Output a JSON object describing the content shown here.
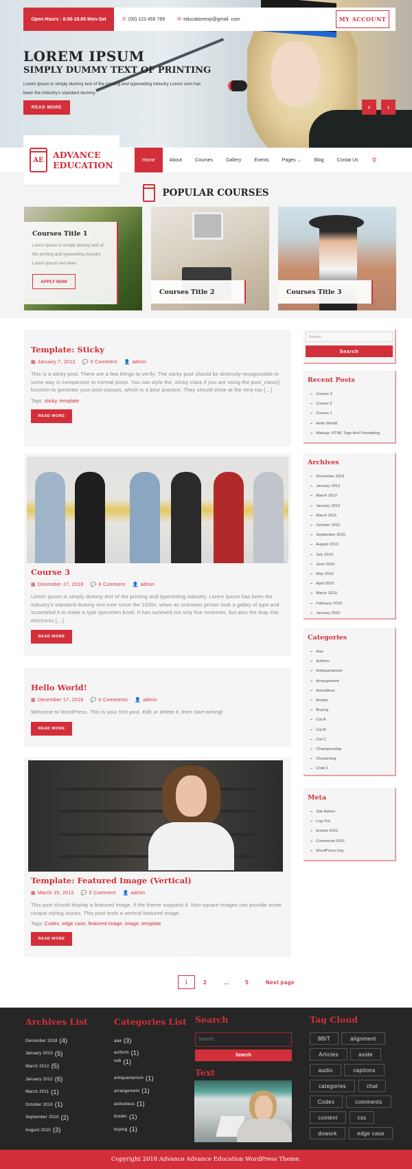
{
  "topbar": {
    "hours": "Open Hours : 8.00-18.00 Mon-Sat",
    "phone": "(00) 123 456 789",
    "email": "educationexp@gmail .com",
    "my_account": "MY ACCOUNT"
  },
  "hero": {
    "title": "LOREM IPSUM",
    "subtitle": "SIMPLY DUMMY TEXT OF PRINTING",
    "text": "Lorem Ipsum is simply dummy text of the printing and typesetting industry Lorem sum has been the industry's standard dummy.",
    "read_more": "READ MORE",
    "prev_icon": "‹",
    "next_icon": "›"
  },
  "logo": {
    "initials": "AE",
    "line1": "ADVANCE",
    "line2": "EDUCATION"
  },
  "nav": {
    "items": [
      "Home",
      "About",
      "Courses",
      "Gallery",
      "Events",
      "Pages",
      "Blog",
      "Contat Us"
    ],
    "active": "Home",
    "dropdown_icon": "⌄",
    "search_icon": "⚲"
  },
  "popular": {
    "title": "POPULAR COURSES",
    "courses": [
      {
        "title": "Courses Title 1",
        "text": "Lorem Ipsum is simply dummy text of the printing and typesetting industry Lorem Ipsum has been.",
        "button": "APPLY NOW"
      },
      {
        "title": "Courses Title 2"
      },
      {
        "title": "Courses Title 3"
      }
    ]
  },
  "posts": [
    {
      "title": "Template: Sticky",
      "date": "January 7, 2012",
      "comments": "0 Comment",
      "author": "admin",
      "excerpt": "This is a sticky post. There are a few things to verify: The sticky post should be distinctly recognizable in some way in comparison to normal posts. You can style the .sticky class if you are using the post_class() function to generate your post classes, which is a best practice. They should show at the very top […]",
      "tags_label": "Tags:",
      "tags": [
        "sticky",
        "template"
      ],
      "read_more": "READ MORE"
    },
    {
      "title": "Course 3",
      "date": "December 17, 2018",
      "comments": "0 Comment",
      "author": "admin",
      "excerpt": "Lorem Ipsum is simply dummy text of the printing and typesetting industry. Lorem Ipsum has been the industry's standard dummy text ever since the 1500s, when an unknown printer took a galley of type and scrambled it to make a type specimen book. It has survived not only five centuries, but also the leap into electronic […]",
      "read_more": "READ MORE"
    },
    {
      "title": "Hello World!",
      "date": "December 17, 2018",
      "comments": "0 Comments",
      "author": "admin",
      "excerpt": "Welcome to WordPress. This is your first post. Edit or delete it, then start writing!",
      "read_more": "READ MORE"
    },
    {
      "title": "Template: Featured Image (Vertical)",
      "date": "March 15, 2012",
      "comments": "0 Comment",
      "author": "admin",
      "excerpt": "This post should display a featured image, if the theme supports it. Non-square images can provide some unique styling issues. This post tests a vertical featured image.",
      "tags_label": "Tags:",
      "tags": [
        "Codex",
        "edge case",
        "featured image",
        "image",
        "template"
      ],
      "read_more": "READ MORE"
    }
  ],
  "icons": {
    "calendar": "▦",
    "comments": "💬",
    "user": "👤",
    "phone": "✆",
    "mail": "✉"
  },
  "sidebar": {
    "search_placeholder": "Search",
    "search_button": "Search",
    "recent_posts": {
      "title": "Recent Posts",
      "items": [
        "Course 3",
        "Course 2",
        "Course 1",
        "Hello World!",
        "Markup: HTML Tags And Formatting"
      ]
    },
    "archives": {
      "title": "Archives",
      "items": [
        "December 2018",
        "January 2013",
        "March 2012",
        "January 2012",
        "March 2011",
        "October 2010",
        "September 2010",
        "August 2010",
        "July 2010",
        "June 2010",
        "May 2010",
        "April 2010",
        "March 2010",
        "February 2010",
        "January 2010"
      ]
    },
    "categories": {
      "title": "Categories",
      "items": [
        "Aaa",
        "Aciform",
        "Antiquarianism",
        "Arrangement",
        "Asmodeus",
        "Broder",
        "Buying",
        "Cat A",
        "Cat B",
        "Cat C",
        "Championship",
        "Chastening",
        "Child 1"
      ]
    },
    "meta": {
      "title": "Meta",
      "items": [
        "Site Admin",
        "Log Out",
        "Entries RSS",
        "Comments RSS",
        "WordPress.Org"
      ]
    }
  },
  "pagination": {
    "pages": [
      "1",
      "2"
    ],
    "dots": "…",
    "last": "5",
    "next": "Next page",
    "current": "1"
  },
  "footer": {
    "archives": {
      "title": "Archives List",
      "items": [
        {
          "label": "December 2018",
          "count": "(4)"
        },
        {
          "label": "January 2013",
          "count": "(5)"
        },
        {
          "label": "March 2012",
          "count": "(5)"
        },
        {
          "label": "January 2012",
          "count": "(6)"
        },
        {
          "label": "March 2011",
          "count": "(1)"
        },
        {
          "label": "October 2010",
          "count": "(1)"
        },
        {
          "label": "September 2010",
          "count": "(2)"
        },
        {
          "label": "August 2010",
          "count": "(3)"
        }
      ]
    },
    "categories": {
      "title": "Categories List",
      "items": [
        {
          "label": "aaa",
          "count": "(3)"
        },
        {
          "label": "aciform",
          "count": "(1)"
        },
        {
          "label": "sub",
          "count": "(1)"
        },
        {
          "label": "antiquarianism",
          "count": "(1)"
        },
        {
          "label": "arrangement",
          "count": "(1)"
        },
        {
          "label": "asmodeus",
          "count": "(1)"
        },
        {
          "label": "broder",
          "count": "(1)"
        },
        {
          "label": "buying",
          "count": "(1)"
        }
      ]
    },
    "search": {
      "title": "Search",
      "placeholder": "Search",
      "button": "Search"
    },
    "text_widget": {
      "title": "Text"
    },
    "tag_cloud": {
      "title": "Tag Cloud",
      "tags": [
        "8BIT",
        "alignment",
        "Articles",
        "aside",
        "audio",
        "captions",
        "categories",
        "chat",
        "Codex",
        "comments",
        "content",
        "css",
        "dowork",
        "edge case"
      ]
    },
    "copyright": "Copyright 2018 Advance Advance Education WordPress Theme."
  }
}
